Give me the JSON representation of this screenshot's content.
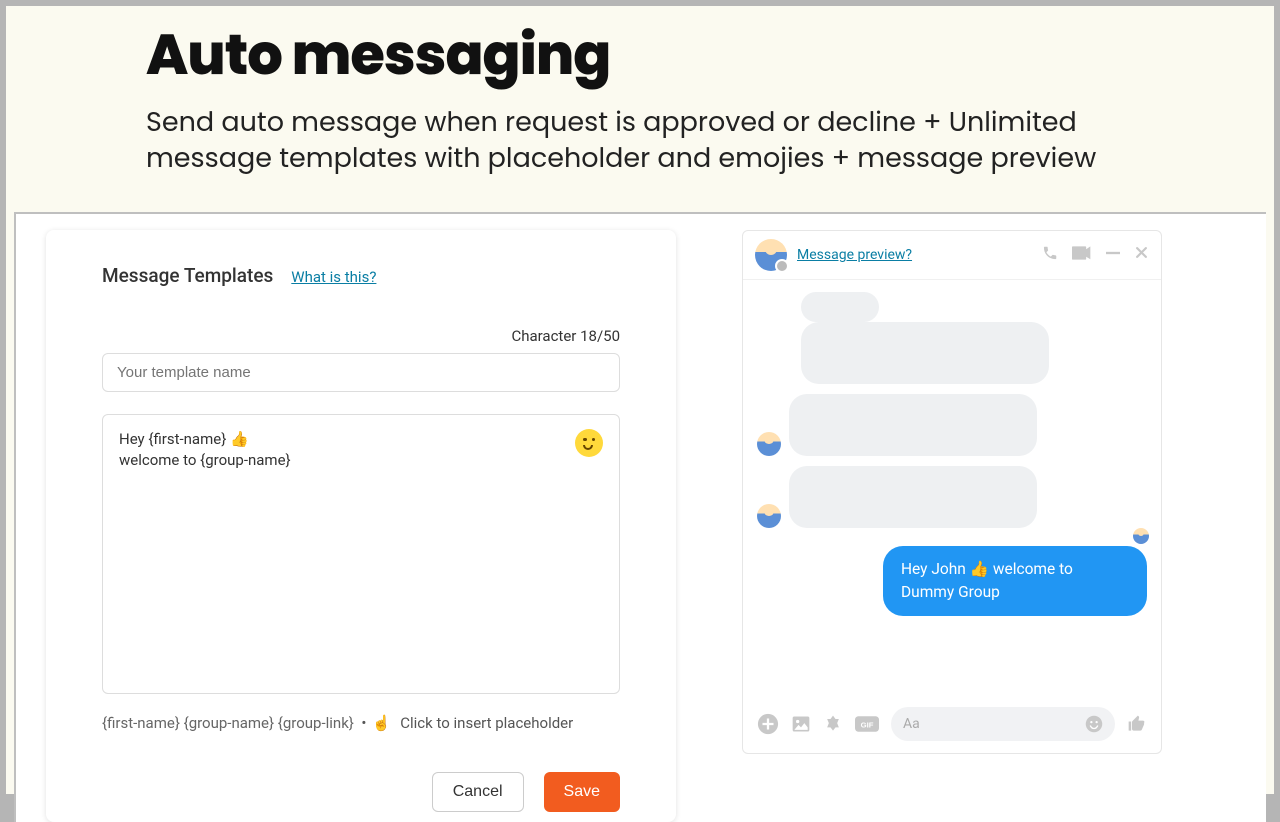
{
  "header": {
    "title": "Auto messaging",
    "subtitle": "Send auto message when request is approved or decline + Unlimited message templates with placeholder and emojies + message preview"
  },
  "card": {
    "title": "Message Templates",
    "help_link": "What is this?",
    "char_label": "Character 18/50",
    "name_placeholder": "Your template name",
    "message_line1": "Hey {first-name} 👍",
    "message_line2": "welcome to  {group-name}",
    "placeholders": "{first-name} {group-name} {group-link}",
    "hint_text": "Click to insert placeholder",
    "cancel": "Cancel",
    "save": "Save"
  },
  "preview": {
    "header_link": "Message preview?",
    "sent_message": "Hey John 👍 welcome to Dummy Group",
    "input_placeholder": "Aa"
  }
}
